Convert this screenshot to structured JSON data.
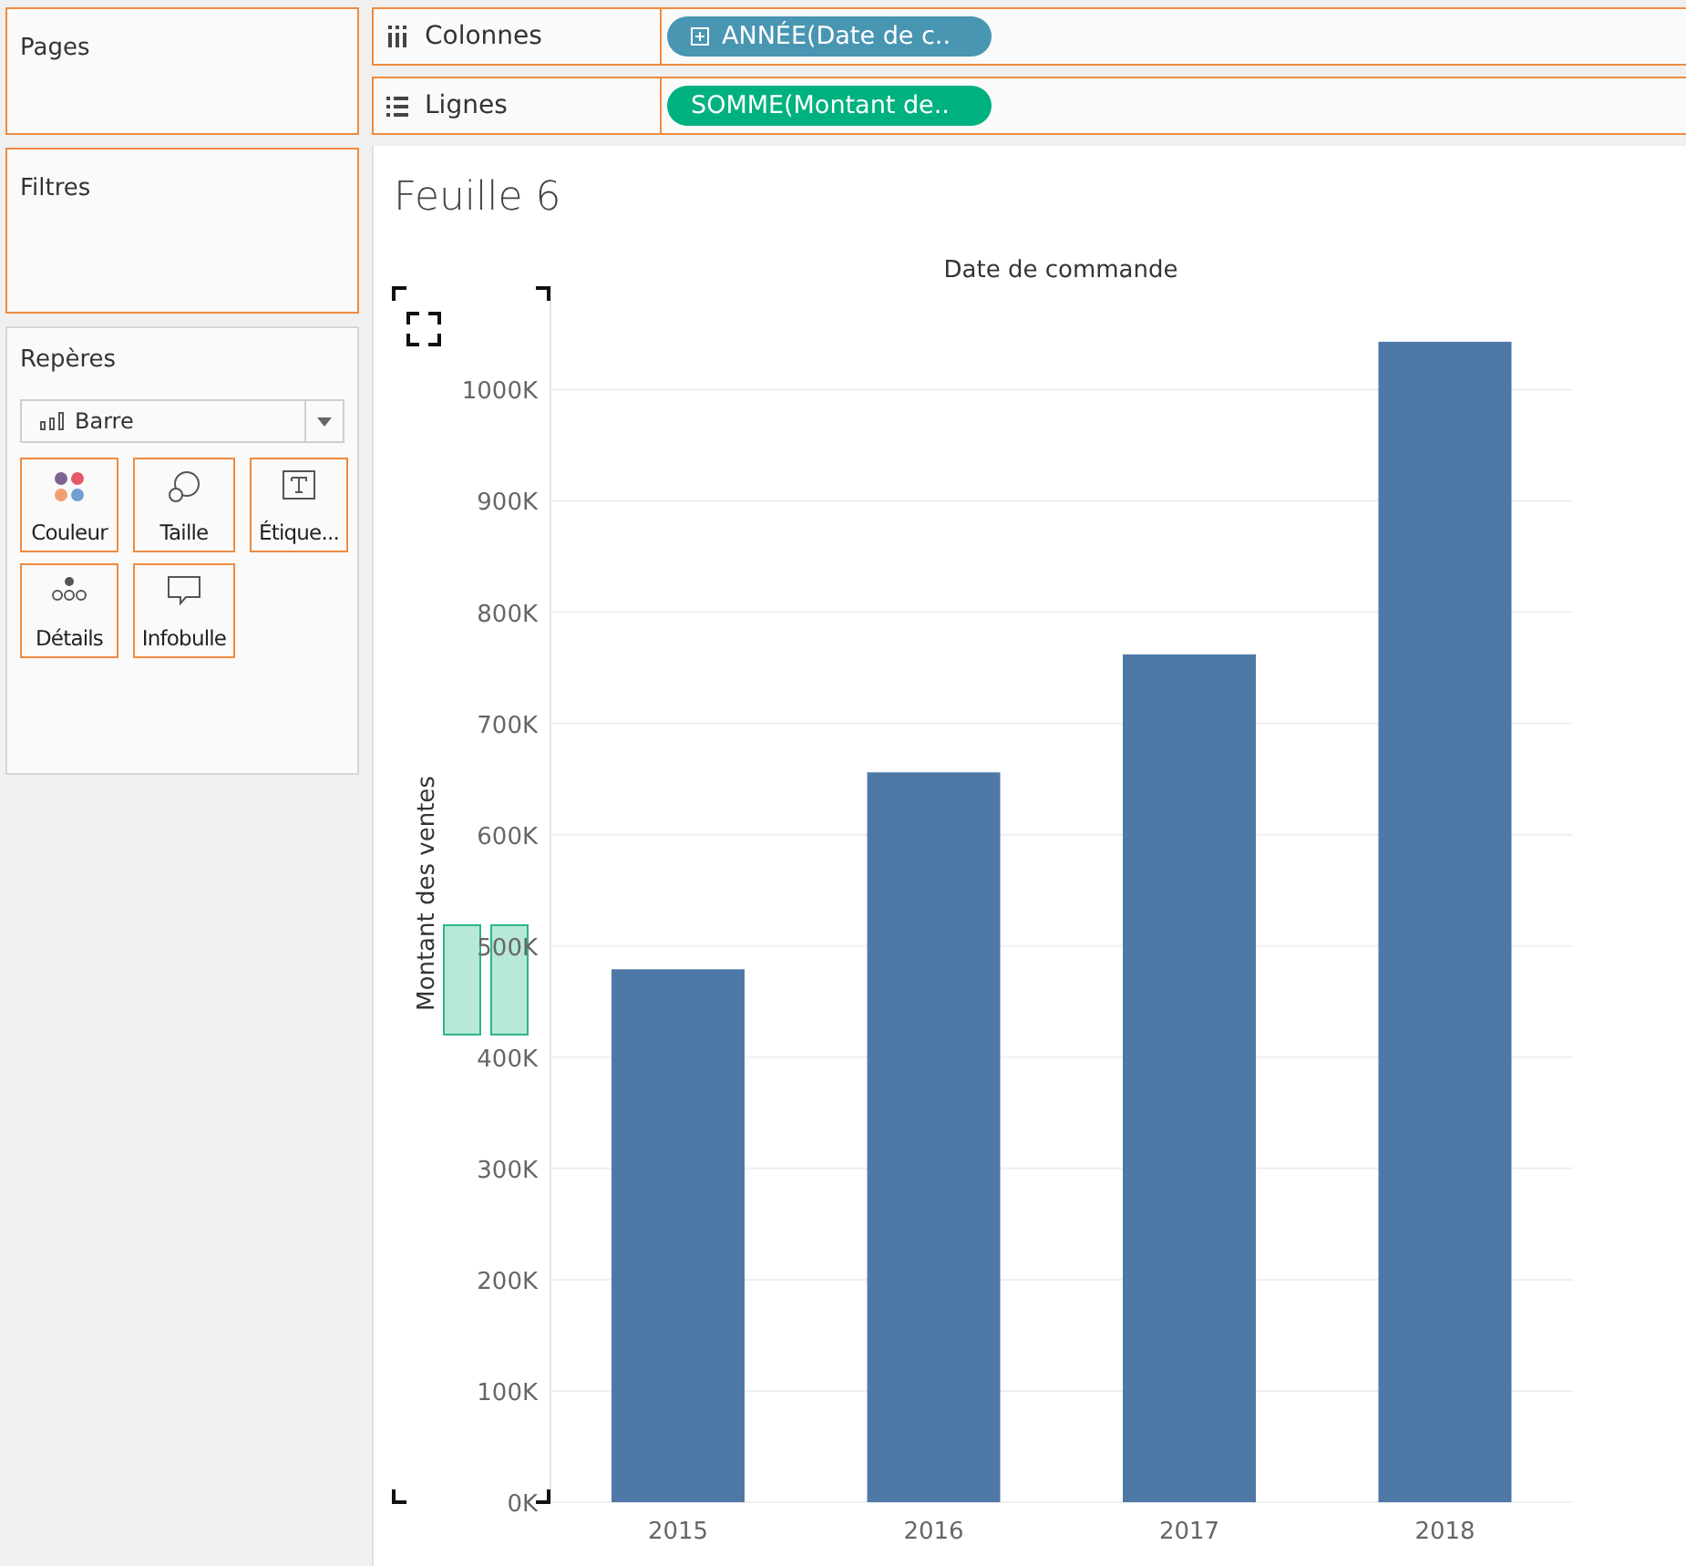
{
  "side": {
    "pages": {
      "title": "Pages"
    },
    "filters": {
      "title": "Filtres"
    },
    "marks": {
      "title": "Repères",
      "mark_type": "Barre",
      "buttons": [
        {
          "kind": "color",
          "label": "Couleur"
        },
        {
          "kind": "size",
          "label": "Taille"
        },
        {
          "kind": "label",
          "label": "Étique..."
        },
        {
          "kind": "detail",
          "label": "Détails"
        },
        {
          "kind": "tooltip",
          "label": "Infobulle"
        }
      ]
    }
  },
  "shelves": [
    {
      "kind": "columns",
      "label": "Colonnes",
      "pill": "ANNÉE(Date de c..",
      "color": "#4996b2"
    },
    {
      "kind": "rows",
      "label": "Lignes",
      "pill": "SOMME(Montant de..",
      "color": "#00b180"
    }
  ],
  "sheet": {
    "title": "Feuille 6",
    "chart_data": {
      "type": "bar",
      "title": "Date de commande",
      "ylabel": "Montant des ventes",
      "categories": [
        "2015",
        "2016",
        "2017",
        "2018"
      ],
      "series": [
        {
          "color": "#4e79a7",
          "values": [
            479000,
            656000,
            762000,
            1043000
          ]
        }
      ],
      "grid": true,
      "ylim": [
        0,
        1088000
      ],
      "yticks": [
        {
          "value": 0,
          "label": "0K"
        },
        {
          "value": 100000,
          "label": "100K"
        },
        {
          "value": 200000,
          "label": "200K"
        },
        {
          "value": 300000,
          "label": "300K"
        },
        {
          "value": 400000,
          "label": "400K"
        },
        {
          "value": 500000,
          "label": "500K"
        },
        {
          "value": 600000,
          "label": "600K"
        },
        {
          "value": 700000,
          "label": "700K"
        },
        {
          "value": 800000,
          "label": "800K"
        },
        {
          "value": 900000,
          "label": "900K"
        },
        {
          "value": 1000000,
          "label": "1000K"
        }
      ]
    }
  }
}
